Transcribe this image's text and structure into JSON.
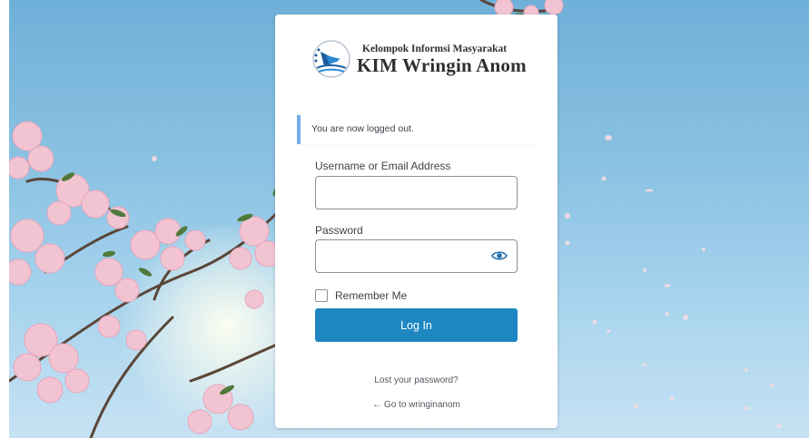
{
  "logo": {
    "subtitle": "Kelompok Informsi Masyarakat",
    "title": "KIM Wringin Anom"
  },
  "notice": {
    "message": "You are now logged out."
  },
  "form": {
    "username_label": "Username or Email Address",
    "username_value": "",
    "password_label": "Password",
    "password_value": "",
    "remember_label": "Remember Me",
    "remember_checked": false,
    "submit_label": "Log In"
  },
  "links": {
    "lost_password": "Lost your password?",
    "back_to_site": "← Go to wringinanom"
  },
  "colors": {
    "button": "#1e87c2",
    "notice_border": "#72aee6",
    "sky": "#8cc3e3",
    "blossom": "#f2c4d2"
  },
  "icons": {
    "logo": "kim-logo-icon",
    "password_toggle": "eye-icon"
  }
}
